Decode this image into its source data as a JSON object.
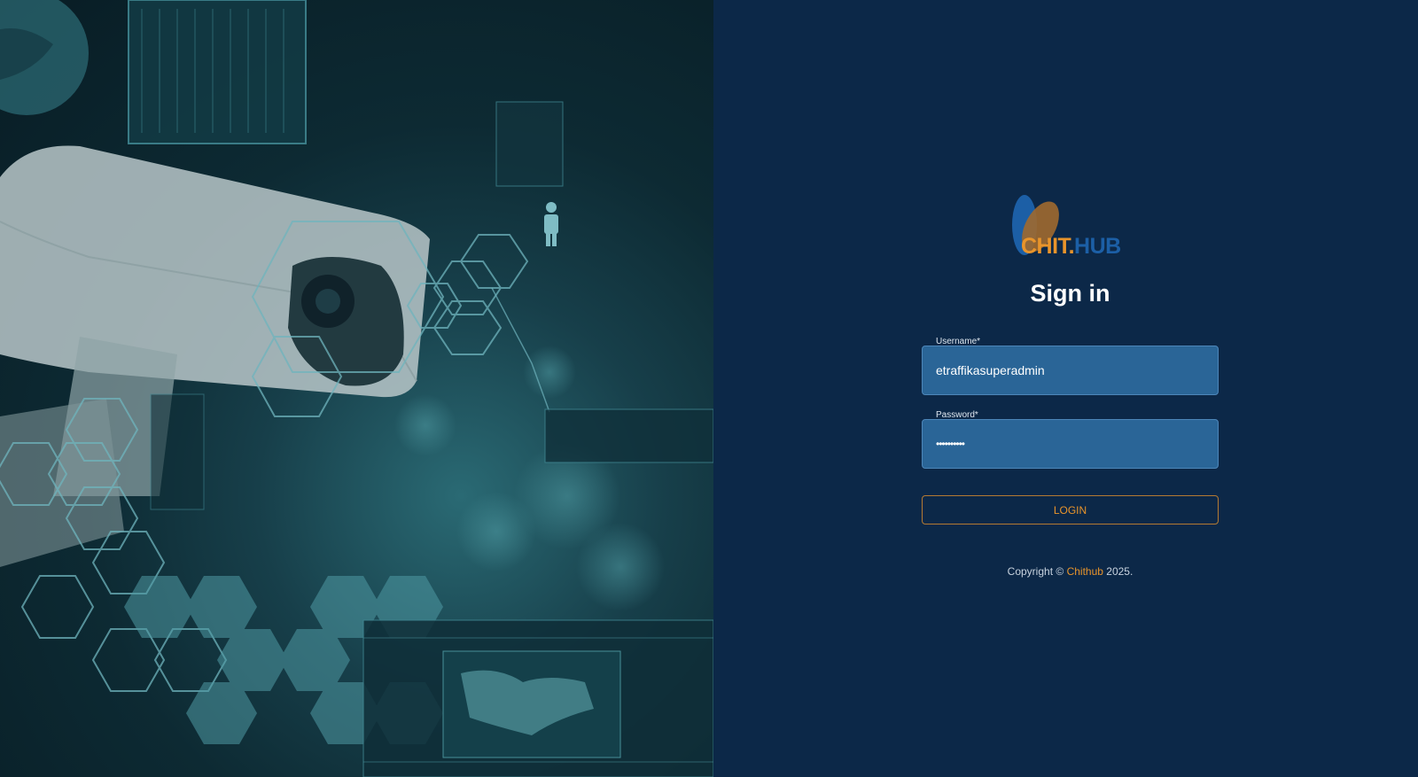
{
  "logo": {
    "text_chit": "CHIT",
    "text_hub": "HUB",
    "dot": ".",
    "colors": {
      "orange": "#e8942b",
      "blue": "#1c5fa6"
    }
  },
  "form": {
    "title": "Sign in",
    "username": {
      "label": "Username",
      "required_mark": "*",
      "value": "etraffikasuperadmin"
    },
    "password": {
      "label": "Password",
      "required_mark": "*",
      "value": "••••••••••"
    },
    "login_label": "LOGIN"
  },
  "footer": {
    "prefix": "Copyright ©",
    "brand": "Chithub",
    "suffix": "2025."
  },
  "theme": {
    "panel_bg": "#0c2848",
    "field_bg": "#2a6597",
    "accent": "#e8942b"
  }
}
